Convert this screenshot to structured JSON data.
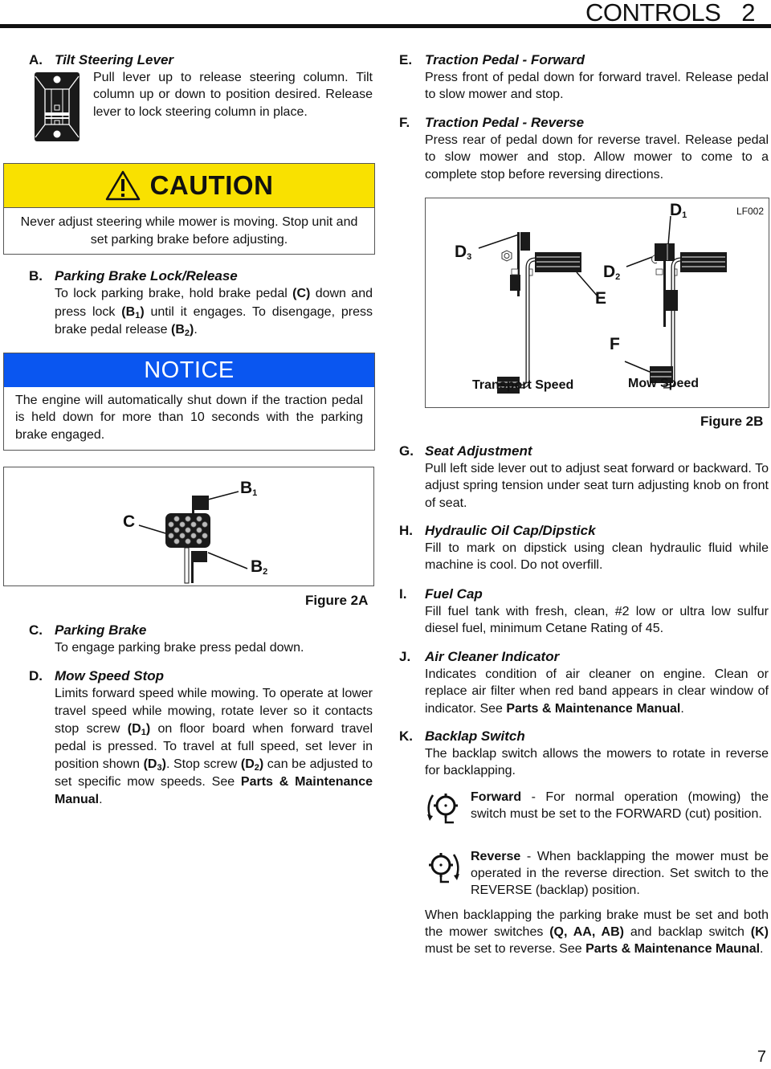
{
  "header": {
    "section": "CONTROLS",
    "number": "2"
  },
  "page_number": "7",
  "sections": {
    "A": {
      "letter": "A.",
      "title": "Tilt Steering Lever",
      "text": "Pull lever up to release steering column. Tilt column up or down to position desired. Release lever to lock steering column in place.",
      "icon": "tilt-steering-lever-icon"
    },
    "B": {
      "letter": "B.",
      "title": "Parking Brake Lock/Release",
      "text_1": "To lock parking brake, hold brake pedal ",
      "ref_c": "(C)",
      "text_2": " down and press lock ",
      "ref_b1": "(B",
      "sub_1": "1",
      "close_1": ")",
      "text_3": " until it engages. To disengage, press brake pedal release ",
      "ref_b2": "(B",
      "sub_2": "2",
      "close_2": ")",
      "text_4": "."
    },
    "C": {
      "letter": "C.",
      "title": "Parking Brake",
      "text": "To engage parking brake press pedal down."
    },
    "D": {
      "letter": "D.",
      "title": "Mow Speed Stop",
      "text_1": "Limits forward speed while mowing. To operate at lower travel speed while mowing, rotate lever so it contacts stop screw ",
      "ref_d1": "(D",
      "sub_d1": "1",
      "close": ")",
      "text_2": " on floor board when forward travel pedal is pressed. To travel at full speed, set lever in position shown ",
      "ref_d3": "(D",
      "sub_d3": "3",
      "text_3": ". Stop screw ",
      "ref_d2": "(D",
      "sub_d2": "2",
      "text_4": " can be adjusted to set specific mow speeds. See ",
      "manual": "Parts & Maintenance Manual",
      "text_5": "."
    },
    "E": {
      "letter": "E.",
      "title": "Traction Pedal - Forward",
      "text": "Press front of pedal down for forward travel. Release pedal to slow mower and stop."
    },
    "F": {
      "letter": "F.",
      "title": "Traction Pedal - Reverse",
      "text": "Press rear of pedal down for reverse travel. Release pedal to slow mower and stop. Allow mower to come to a complete stop before reversing directions."
    },
    "G": {
      "letter": "G.",
      "title": "Seat Adjustment",
      "text": "Pull left side lever out to adjust seat forward or backward. To adjust spring tension under seat turn adjusting knob on front of seat."
    },
    "H": {
      "letter": "H.",
      "title": "Hydraulic Oil Cap/Dipstick",
      "text": "Fill to mark on dipstick using clean hydraulic fluid while machine is cool. Do not overfill."
    },
    "I": {
      "letter": "I.",
      "title": "Fuel Cap",
      "text": "Fill fuel tank with fresh, clean, #2 low or ultra low sulfur diesel fuel, minimum Cetane Rating of 45."
    },
    "J": {
      "letter": "J.",
      "title": "Air Cleaner Indicator",
      "text": "Indicates condition of air cleaner on engine. Clean or replace air filter when red band appears in clear window of indicator. See ",
      "manual": "Parts & Maintenance Manual",
      "end": "."
    },
    "K": {
      "letter": "K.",
      "title": "Backlap Switch",
      "text": "The backlap switch allows the mowers to rotate in reverse for backlapping.",
      "forward_label": "Forward",
      "forward_text": " - For normal operation (mowing) the switch must be set to the FORWARD (cut) position.",
      "reverse_label": "Reverse",
      "reverse_text": " - When backlapping the mower must be operated in the reverse direction. Set switch to the REVERSE (backlap) position.",
      "note_1": "When backlapping the parking brake must be set and both the mower switches ",
      "note_refs": "(Q, AA, AB)",
      "note_2": " and backlap switch ",
      "note_k": "(K)",
      "note_3": " must be set to reverse. See ",
      "note_manual": "Parts & Maintenance Maunal",
      "note_4": "."
    }
  },
  "caution": {
    "label": "CAUTION",
    "text": "Never adjust steering while mower is moving. Stop unit and set parking brake before adjusting.",
    "color": "#f9e100"
  },
  "notice": {
    "label": "NOTICE",
    "text": "The engine will automatically shut down if the traction pedal is held down for more than 10 seconds with the parking brake engaged.",
    "color": "#0a56f0"
  },
  "figure_2a": {
    "caption": "Figure 2A",
    "labels": {
      "c": "C",
      "b1": "B",
      "b1_sub": "1",
      "b2": "B",
      "b2_sub": "2"
    }
  },
  "figure_2b": {
    "caption": "Figure 2B",
    "code": "LF002",
    "labels": {
      "d1": "D",
      "d1_sub": "1",
      "d2": "D",
      "d2_sub": "2",
      "d3": "D",
      "d3_sub": "3",
      "e": "E",
      "f": "F"
    },
    "transport": "Transport Speed",
    "mow": "Mow Speed"
  }
}
